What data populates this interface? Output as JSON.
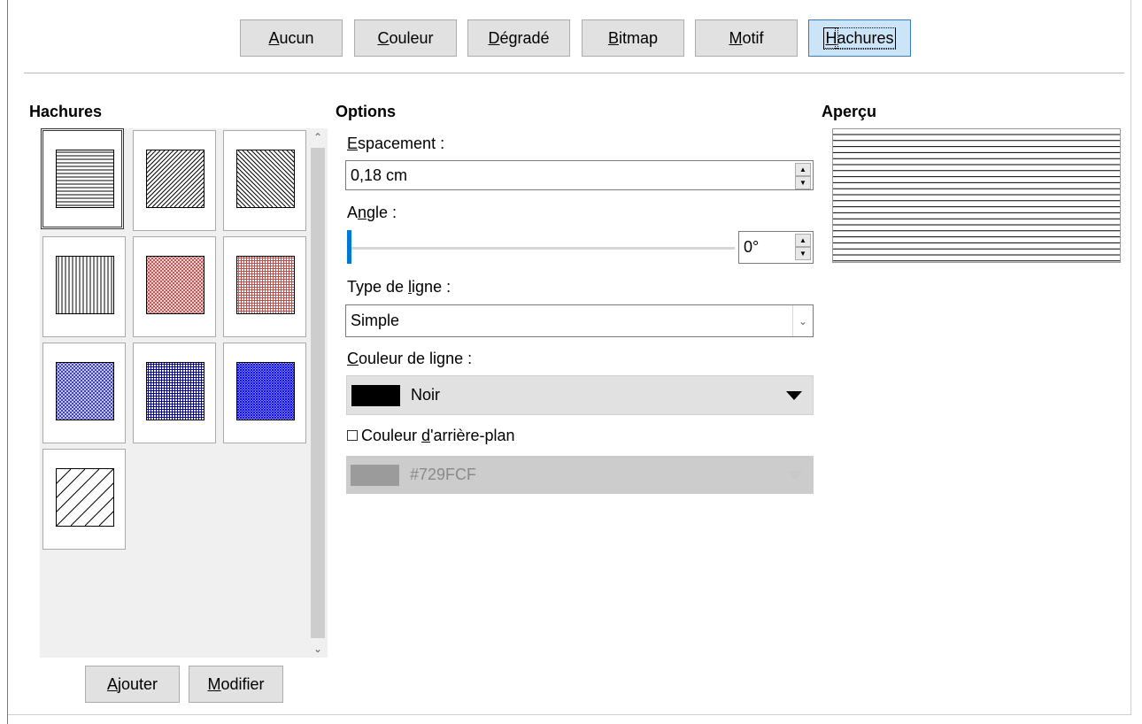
{
  "tabs": [
    {
      "label": "Aucun",
      "mnemonic": "A",
      "rest": "ucun"
    },
    {
      "label": "Couleur",
      "mnemonic": "C",
      "rest": "ouleur"
    },
    {
      "label": "Dégradé",
      "mnemonic": "D",
      "rest": "égradé"
    },
    {
      "label": "Bitmap",
      "mnemonic": "B",
      "rest": "itmap"
    },
    {
      "label": "Motif",
      "mnemonic": "M",
      "rest": "otif"
    },
    {
      "label": "Hachures",
      "mnemonic": "H",
      "rest": "achures",
      "active": true
    }
  ],
  "hatch_list": {
    "heading": "Hachures",
    "selected_index": 0,
    "tiles": [
      {
        "pattern": "horizontal",
        "color": "#000000"
      },
      {
        "pattern": "diag45",
        "color": "#000000"
      },
      {
        "pattern": "diag-45",
        "color": "#000000"
      },
      {
        "pattern": "vertical",
        "color": "#000000"
      },
      {
        "pattern": "crossdiag",
        "color": "#c0504d"
      },
      {
        "pattern": "crossgrid",
        "color": "#c0504d"
      },
      {
        "pattern": "crossdiag",
        "color": "#3333cc"
      },
      {
        "pattern": "crossgrid",
        "color": "#0000aa"
      },
      {
        "pattern": "crossdiag-dense",
        "color": "#0000ff"
      },
      {
        "pattern": "diag45-wide",
        "color": "#000000"
      }
    ],
    "buttons": {
      "add": {
        "mnemonic": "A",
        "rest": "jouter"
      },
      "modify": {
        "mnemonic": "M",
        "rest": "odifier"
      }
    }
  },
  "options": {
    "heading": "Options",
    "spacing_label_mn": "E",
    "spacing_label_rest": "spacement :",
    "spacing_value": "0,18 cm",
    "angle_label_pre": "A",
    "angle_label_mn": "n",
    "angle_label_rest": "gle :",
    "angle_value": "0°",
    "line_type_label_pre": "Type de ",
    "line_type_label_mn": "l",
    "line_type_label_rest": "igne :",
    "line_type_value": "Simple",
    "line_color_label_mn": "C",
    "line_color_label_rest": "ouleur de ligne :",
    "line_color_name": "Noir",
    "line_color_hex": "#000000",
    "bg_label_pre": "Couleur ",
    "bg_label_mn": "d",
    "bg_label_rest": "'arrière-plan",
    "bg_checked": false,
    "bg_color_name": "#729FCF",
    "bg_swatch": "#9b9b9b"
  },
  "preview": {
    "heading": "Aperçu",
    "pattern": "horizontal"
  }
}
